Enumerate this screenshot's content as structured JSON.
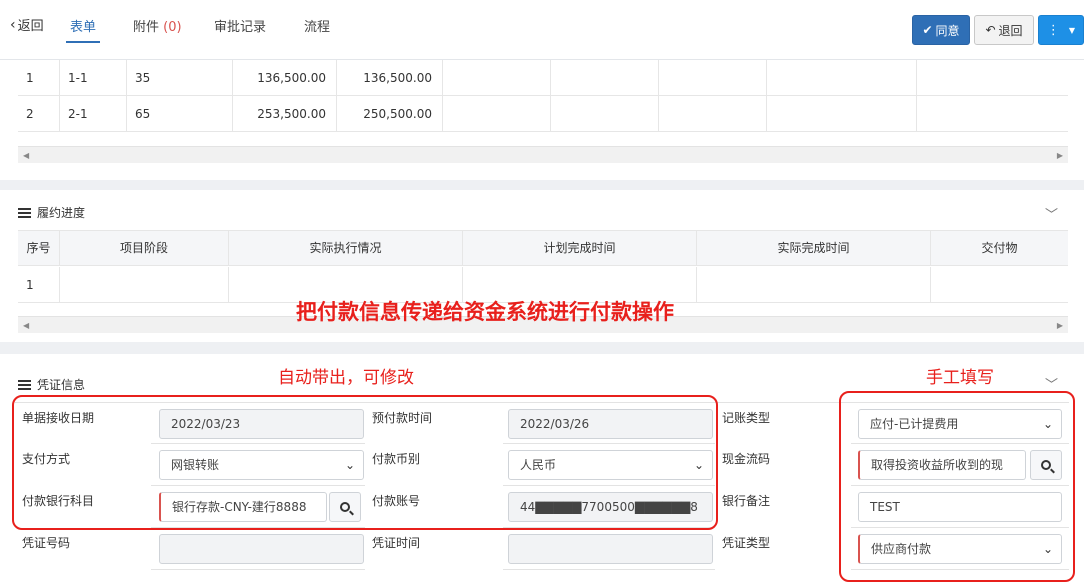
{
  "topbar": {
    "back_label": "返回",
    "tabs": [
      {
        "label": "表单"
      },
      {
        "label": "附件",
        "count": "(0)"
      },
      {
        "label": "审批记录"
      },
      {
        "label": "流程"
      }
    ],
    "approve_label": "同意",
    "reject_label": "退回"
  },
  "top_table": {
    "rows": [
      [
        "1",
        "1-1",
        "35",
        "136,500.00",
        "136,500.00"
      ],
      [
        "2",
        "2-1",
        "65",
        "253,500.00",
        "250,500.00"
      ]
    ]
  },
  "progress": {
    "title": "履约进度",
    "headers": [
      "序号",
      "项目阶段",
      "实际执行情况",
      "计划完成时间",
      "实际完成时间",
      "交付物"
    ],
    "rows": [
      [
        "1"
      ]
    ]
  },
  "voucher": {
    "title": "凭证信息",
    "rows": [
      {
        "l1": "单据接收日期",
        "v1": "2022/03/23",
        "l2": "预付款时间",
        "v2": "2022/03/26",
        "l3": "记账类型",
        "v3": "应付-已计提费用"
      },
      {
        "l1": "支付方式",
        "v1": "网银转账",
        "l2": "付款币别",
        "v2": "人民币",
        "l3": "现金流码",
        "v3": "取得投资收益所收到的现"
      },
      {
        "l1": "付款银行科目",
        "v1": "银行存款-CNY-建行8888",
        "l2": "付款账号",
        "v2": "44▇▇▇▇▇7700500▇▇▇▇▇▇8",
        "l3": "银行备注",
        "v3": "TEST"
      },
      {
        "l1": "凭证号码",
        "v1": "",
        "l2": "凭证时间",
        "v2": "",
        "l3": "凭证类型",
        "v3": "供应商付款"
      }
    ]
  },
  "annotations": {
    "center": "把付款信息传递给资金系统进行付款操作",
    "left": "自动带出，可修改",
    "right": "手工填写"
  },
  "colors": {
    "primary": "#2f6fb6",
    "annotation": "#e8201c"
  }
}
